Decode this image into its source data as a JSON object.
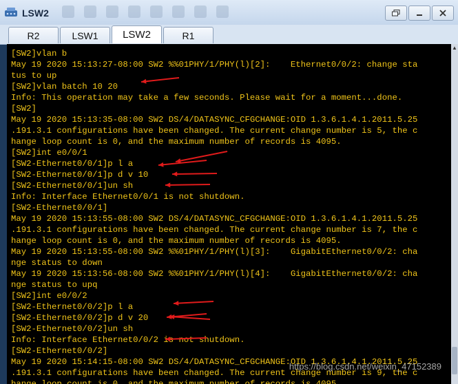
{
  "window": {
    "title": "LSW2"
  },
  "tabs": [
    {
      "label": "R2",
      "active": false
    },
    {
      "label": "LSW1",
      "active": false
    },
    {
      "label": "LSW2",
      "active": true
    },
    {
      "label": "R1",
      "active": false
    }
  ],
  "terminal": {
    "lines": [
      "[SW2]vlan b",
      "May 19 2020 15:13:27-08:00 SW2 %%01PHY/1/PHY(l)[2]:    Ethernet0/0/2: change sta",
      "tus to up",
      "[SW2]vlan batch 10 20",
      "Info: This operation may take a few seconds. Please wait for a moment...done.",
      "[SW2]",
      "May 19 2020 15:13:35-08:00 SW2 DS/4/DATASYNC_CFGCHANGE:OID 1.3.6.1.4.1.2011.5.25",
      ".191.3.1 configurations have been changed. The current change number is 5, the c",
      "hange loop count is 0, and the maximum number of records is 4095.",
      "[SW2]int e0/0/1",
      "[SW2-Ethernet0/0/1]p l a",
      "[SW2-Ethernet0/0/1]p d v 10",
      "[SW2-Ethernet0/0/1]un sh",
      "Info: Interface Ethernet0/0/1 is not shutdown.",
      "[SW2-Ethernet0/0/1]",
      "May 19 2020 15:13:55-08:00 SW2 DS/4/DATASYNC_CFGCHANGE:OID 1.3.6.1.4.1.2011.5.25",
      ".191.3.1 configurations have been changed. The current change number is 7, the c",
      "hange loop count is 0, and the maximum number of records is 4095.",
      "May 19 2020 15:13:55-08:00 SW2 %%01PHY/1/PHY(l)[3]:    GigabitEthernet0/0/2: cha",
      "nge status to down",
      "May 19 2020 15:13:56-08:00 SW2 %%01PHY/1/PHY(l)[4]:    GigabitEthernet0/0/2: cha",
      "nge status to upq",
      "[SW2]int e0/0/2",
      "[SW2-Ethernet0/0/2]p l a",
      "[SW2-Ethernet0/0/2]p d v 20",
      "[SW2-Ethernet0/0/2]un sh",
      "Info: Interface Ethernet0/0/2 is not shutdown.",
      "[SW2-Ethernet0/0/2]",
      "May 19 2020 15:14:15-08:00 SW2 DS/4/DATASYNC_CFGCHANGE:OID 1.3.6.1.4.1.2011.5.25",
      ".191.3.1 configurations have been changed. The current change number is 9, the c",
      "hange loop count is 0, and the maximum number of records is 4095."
    ]
  },
  "watermark": "https://blog.csdn.net/weixin_47152389",
  "colors": {
    "terminal_text": "#f0c419",
    "terminal_bg": "#000000",
    "annotation_arrow": "#e01b1b"
  }
}
